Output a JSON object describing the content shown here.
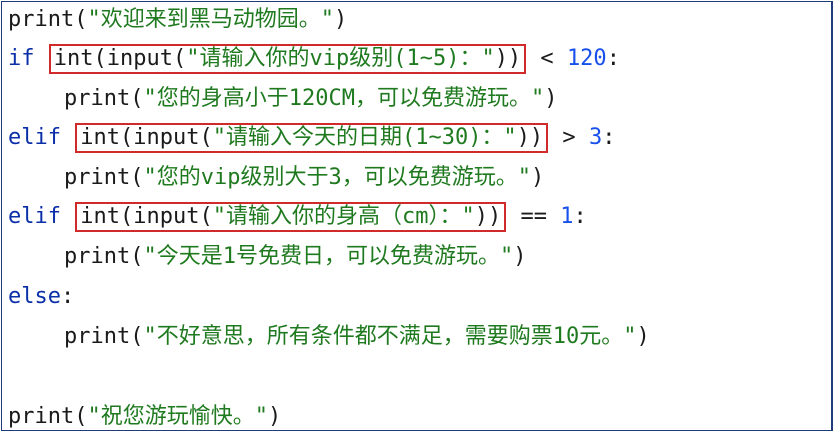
{
  "code": {
    "line1": {
      "fn": "print",
      "open": "(",
      "str": "\"欢迎来到黑马动物园。\"",
      "close": ")"
    },
    "line2": {
      "kw": "if",
      "hl": {
        "fn": "int",
        "open": "(",
        "fn2": "input",
        "open2": "(",
        "str": "\"请输入你的vip级别(1~5)：\"",
        "close": "))"
      },
      "op": " < ",
      "num": "120",
      "colon": ":"
    },
    "line3": {
      "fn": "print",
      "open": "(",
      "str": "\"您的身高小于120CM，可以免费游玩。\"",
      "close": ")"
    },
    "line4": {
      "kw": "elif",
      "hl": {
        "fn": "int",
        "open": "(",
        "fn2": "input",
        "open2": "(",
        "str": "\"请输入今天的日期(1~30)：\"",
        "close": "))"
      },
      "op": " > ",
      "num": "3",
      "colon": ":"
    },
    "line5": {
      "fn": "print",
      "open": "(",
      "str": "\"您的vip级别大于3，可以免费游玩。\"",
      "close": ")"
    },
    "line6": {
      "kw": "elif",
      "hl": {
        "fn": "int",
        "open": "(",
        "fn2": "input",
        "open2": "(",
        "str": "\"请输入你的身高（cm）：\"",
        "close": "))"
      },
      "op": " == ",
      "num": "1",
      "colon": ":"
    },
    "line7": {
      "fn": "print",
      "open": "(",
      "str": "\"今天是1号免费日，可以免费游玩。\"",
      "close": ")"
    },
    "line8": {
      "kw": "else",
      "colon": ":"
    },
    "line9": {
      "fn": "print",
      "open": "(",
      "str": "\"不好意思，所有条件都不满足，需要购票10元。\"",
      "close": ")"
    },
    "line11": {
      "fn": "print",
      "open": "(",
      "str": "\"祝您游玩愉快。\"",
      "close": ")"
    }
  },
  "colors": {
    "keyword": "#0a2fa8",
    "string": "#1f7a1f",
    "number": "#1750eb",
    "highlight_box": "#d12a2a",
    "frame_border": "#1f3b7a"
  }
}
